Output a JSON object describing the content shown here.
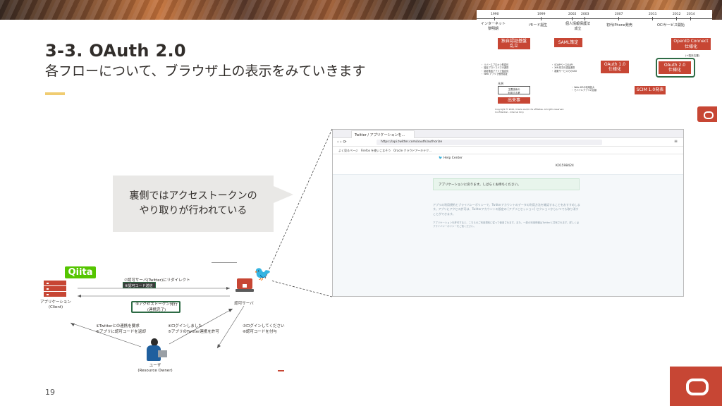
{
  "slide": {
    "title": "3-3. OAuth 2.0",
    "subtitle": "各フローについて、ブラウザ上の表示をみていきます",
    "page_number": "19"
  },
  "timeline": {
    "years": [
      "1990",
      "1999",
      "2002",
      "2003",
      "2007",
      "2011",
      "2012",
      "2014"
    ],
    "labels": {
      "internet": "インターネット\n黎明期",
      "imode": "iモード誕生",
      "privacy": "個人情報保護法\n成立",
      "iphone": "初代iPhone発売",
      "services": "OCIサービス開始"
    },
    "boxes": {
      "auth_chaos": "独自認証基盤\n乱立",
      "saml": "SAML策定",
      "oauth1": "OAuth 1.0\n仕様化",
      "oauth2": "OAuth 2.0\n仕様化",
      "oidc": "OpenID Connect\n仕様化",
      "scim": "SCIM 1.0発表",
      "legend_box": "出来事"
    },
    "legend_title": "凡例",
    "legend_note": "主要技術の\n利用する業",
    "mobile_note": "(+端末位置)",
    "copyright": "Copyright © 2022, Oracle and/or its affiliates. All rights reserved.\nConfidential – Internal Only"
  },
  "browser": {
    "tab_title": "Twitter / アプリケーションを...",
    "url": "https://api.twitter.com/oauth/authorize",
    "bookmarks": [
      "よく見るページ",
      "Firefox を使いこなそう",
      "Oracle クラウドアーキテク..."
    ],
    "help": "Help Center",
    "username": "K01598424",
    "alert": "アプリケーションに戻ります。しばらくお待ちください。",
    "body_text": "アプリの利用規約とプライバシーポリシーで、Twitterアカウントのデータの利用方法を確認することをおすすめします。アプリにアクセス許可は、Twitterアカウントの設定の [アプリとセッション] セクションからいつでも取り消すことができます。",
    "body_text2": "アプリケーションを許可すると、こちらのご利用規約に従って使用されます。また、一部の利用情報はTwitterと共有されます。詳しくはプライバシーポリシーをご覧ください。"
  },
  "callout": {
    "line1": "裏側ではアクセストークンの",
    "line2": "やり取りが行われている"
  },
  "diagram": {
    "qiita": "Qiita",
    "client_label": "アプリケーション\n(Client)",
    "auth_server_label": "認可サーバ",
    "user_label": "ユーザ\n(Resource Owner)",
    "flow_redirect": "⑦認可サーバ(Twitter)にリダイレクト",
    "flow_code": "⑧認可コード送信",
    "flow_token": "⑨アクセストークン発行\n(連携完了)",
    "flow_request": "①Twitterとの連携を要求\n⑥アプリに認可コードを返却",
    "flow_login": "④ログインしました\n⑤アプリのTwitter連携を許可",
    "flow_please_login": "③ログインしてください\n⑥認可コードを付与"
  }
}
